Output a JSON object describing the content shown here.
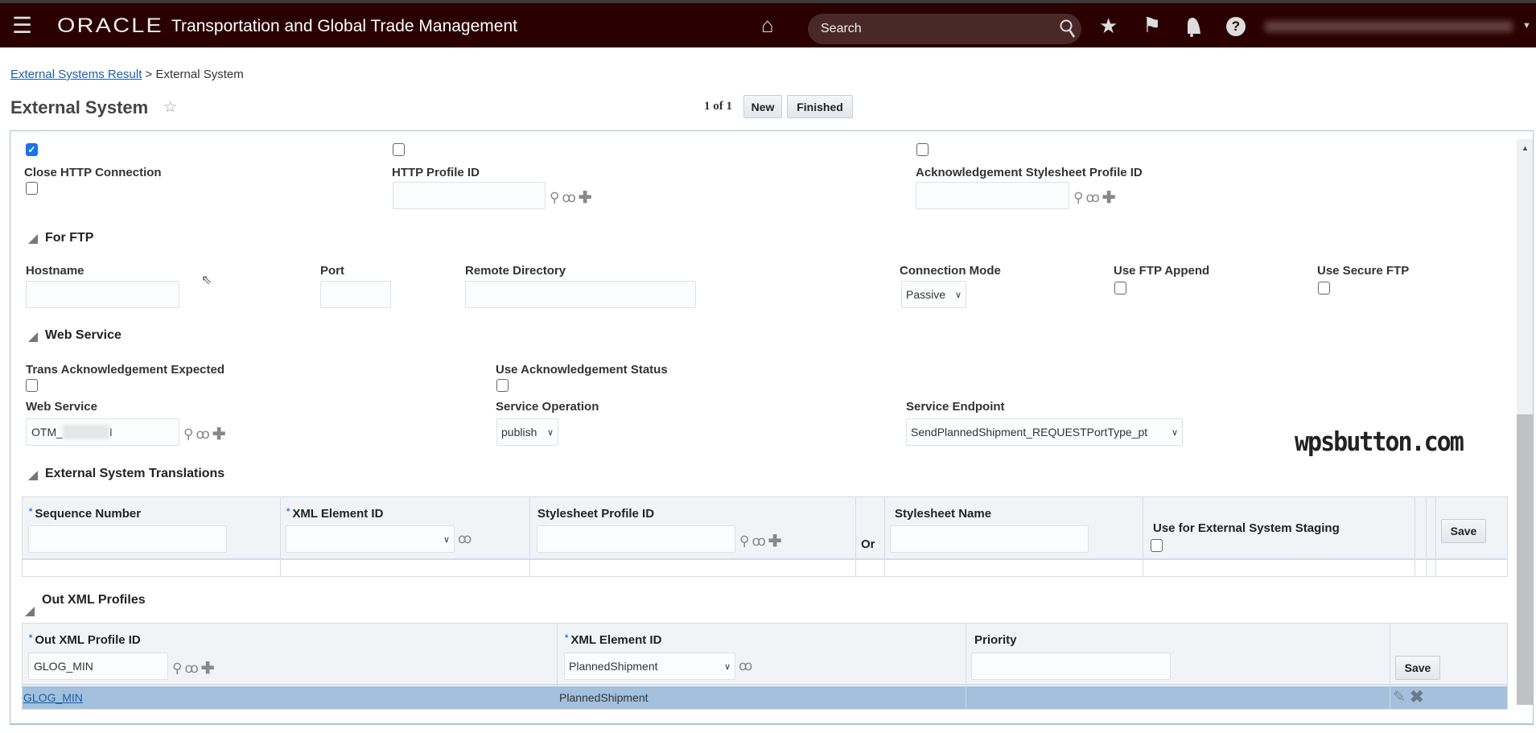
{
  "header": {
    "app_title": "Transportation and Global Trade Management",
    "logo": "ORACLE",
    "search_placeholder": "Search",
    "icons": [
      "menu-icon",
      "home-icon",
      "search-icon",
      "star-icon",
      "flag-icon",
      "bell-icon",
      "help-icon",
      "chevron-down-icon"
    ]
  },
  "breadcrumb": {
    "link": "External Systems Result",
    "separator": " > ",
    "current": "External System"
  },
  "page": {
    "title": "External System",
    "pager": "1 of 1",
    "new_label": "New",
    "finished_label": "Finished"
  },
  "http": {
    "close_http_label": "Close HTTP Connection",
    "http_profile_label": "HTTP Profile ID",
    "ack_stylesheet_label": "Acknowledgement Stylesheet Profile ID",
    "top_checkboxes": [
      true,
      false,
      false
    ]
  },
  "ftp": {
    "title": "For FTP",
    "hostname_label": "Hostname",
    "port_label": "Port",
    "remote_dir_label": "Remote Directory",
    "conn_mode_label": "Connection Mode",
    "conn_mode_value": "Passive",
    "append_label": "Use FTP Append",
    "secure_label": "Use Secure FTP"
  },
  "ws": {
    "title": "Web Service",
    "trans_ack_label": "Trans Acknowledgement Expected",
    "use_ack_label": "Use Acknowledgement Status",
    "web_service_label": "Web Service",
    "web_service_value_prefix": "OTM_",
    "web_service_value_suffix": "I",
    "service_op_label": "Service Operation",
    "service_op_value": "publish",
    "endpoint_label": "Service Endpoint",
    "endpoint_value": "SendPlannedShipment_REQUESTPortType_pt"
  },
  "watermark": "wpsbutton.com",
  "translations": {
    "title": "External System Translations",
    "col_seq": "Sequence Number",
    "col_xml": "XML Element ID",
    "col_stylesheet": "Stylesheet Profile ID",
    "or": "Or",
    "col_stylesheet_name": "Stylesheet Name",
    "col_staging": "Use for External System Staging",
    "save_label": "Save"
  },
  "out_xml": {
    "title": "Out XML Profiles",
    "col_profile": "Out XML Profile ID",
    "col_xml": "XML Element ID",
    "col_priority": "Priority",
    "profile_value": "GLOG_MIN",
    "xml_value": "PlannedShipment",
    "save_label": "Save",
    "rows": [
      {
        "profile": "GLOG_MIN",
        "xml_element": "PlannedShipment",
        "priority": ""
      }
    ]
  },
  "colors": {
    "header_bg": "#2a0000",
    "selected_row": "#a3c1dd",
    "link": "#1f5fa8"
  }
}
